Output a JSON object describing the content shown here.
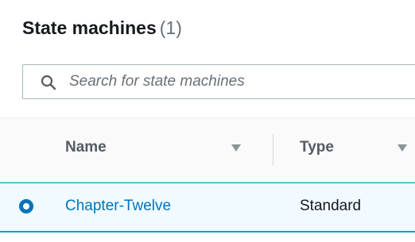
{
  "header": {
    "title": "State machines",
    "count": "(1)"
  },
  "search": {
    "placeholder": "Search for state machines",
    "value": "",
    "icon": "search-icon"
  },
  "table": {
    "columns": [
      {
        "label": "Name",
        "sortable": true
      },
      {
        "label": "Type",
        "sortable": true
      }
    ],
    "rows": [
      {
        "name": "Chapter-Twelve",
        "type": "Standard",
        "selected": true
      }
    ]
  },
  "colors": {
    "link": "#0073bb",
    "selected_row_bg": "#f1faff",
    "selected_row_border": "#00a1c9",
    "header_text": "#545b64",
    "count_text": "#687078"
  }
}
